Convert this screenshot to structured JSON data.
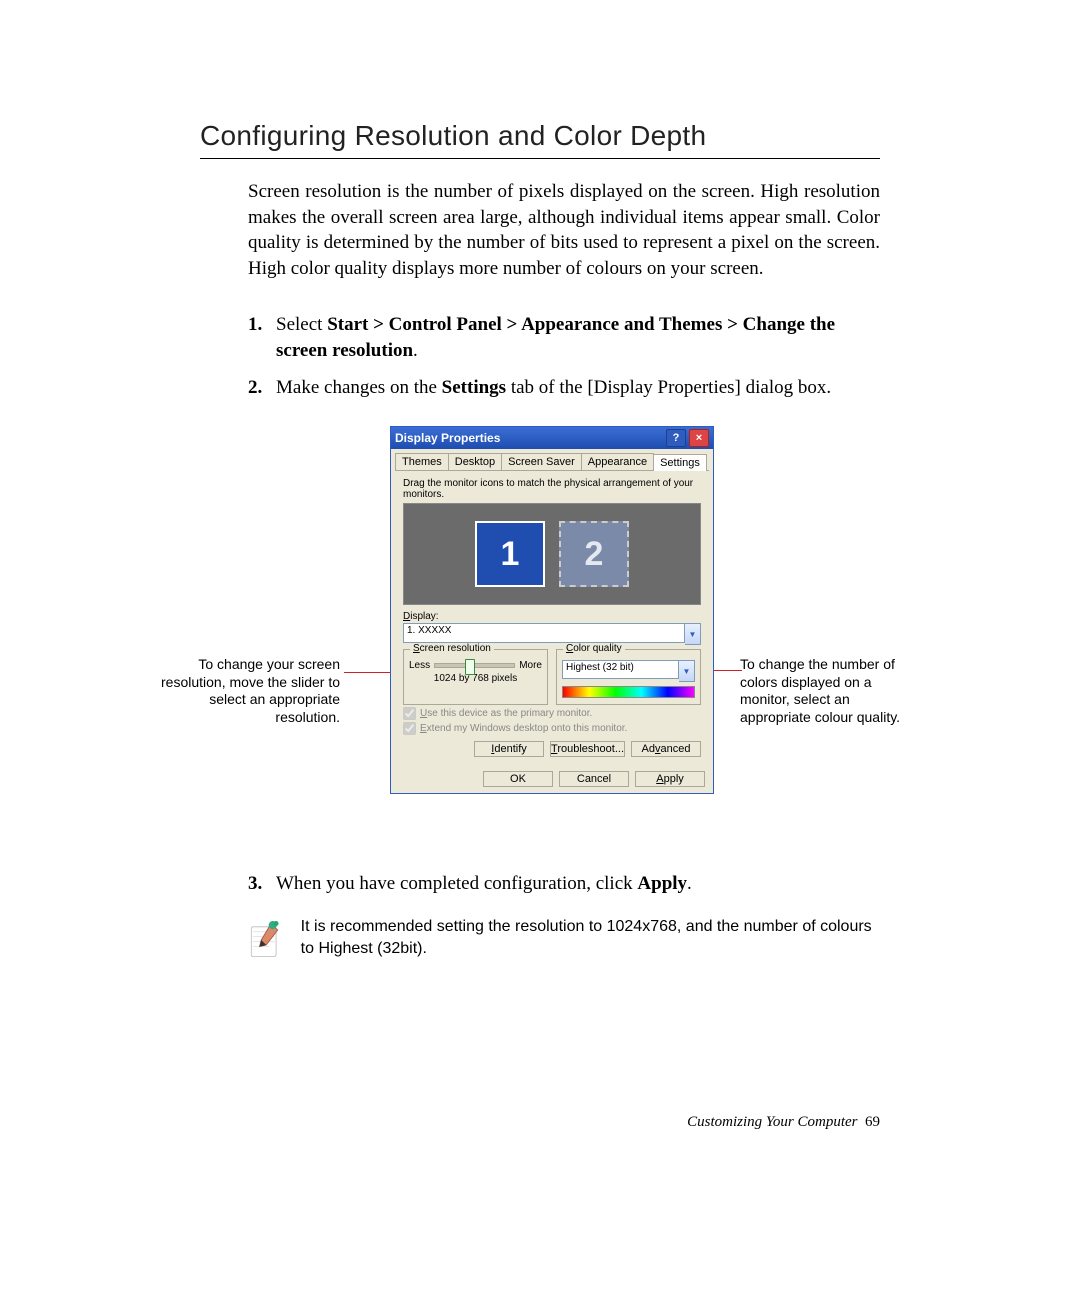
{
  "heading": "Configuring Resolution and Color Depth",
  "intro": "Screen resolution is the number of pixels displayed on the screen. High resolution makes the overall screen area large, although individual items appear small. Color quality is determined by the number of bits used to represent a pixel on the screen. High color quality displays more number of colours on your screen.",
  "steps": {
    "s1": {
      "num": "1.",
      "prefix": "Select ",
      "bold": "Start > Control Panel > Appearance and Themes > Change the screen resolution",
      "suffix": "."
    },
    "s2": {
      "num": "2.",
      "a": "Make changes on the ",
      "bold": "Settings",
      "b": " tab of the [Display Properties] dialog box."
    },
    "s3": {
      "num": "3.",
      "a": "When you have completed configuration, click ",
      "bold": "Apply",
      "b": "."
    }
  },
  "callout_left": "To change your screen resolution, move the slider to select an appropriate resolution.",
  "callout_right": "To change the number of colors displayed on a monitor, select an appropriate colour quality.",
  "note": "It is recommended setting the resolution to 1024x768, and the number of colours to Highest (32bit).",
  "dialog": {
    "title": "Display Properties",
    "tabs": {
      "themes": "Themes",
      "desktop": "Desktop",
      "screensaver": "Screen Saver",
      "appearance": "Appearance",
      "settings": "Settings"
    },
    "arrange_text": "Drag the monitor icons to match the physical arrangement of your monitors.",
    "mon1": "1",
    "mon2": "2",
    "display_label": "Display:",
    "display_value": "1. XXXXX",
    "group_resolution": "Screen resolution",
    "less": "Less",
    "more": "More",
    "res_value": "1024 by 768 pixels",
    "group_quality": "Color quality",
    "quality_value": "Highest (32 bit)",
    "chk1": "Use this device as the primary monitor.",
    "chk2": "Extend my Windows desktop onto this monitor.",
    "identify": "Identify",
    "troubleshoot": "Troubleshoot...",
    "advanced": "Advanced",
    "ok": "OK",
    "cancel": "Cancel",
    "apply": "Apply"
  },
  "footer": {
    "section": "Customizing Your Computer",
    "page": "69"
  }
}
